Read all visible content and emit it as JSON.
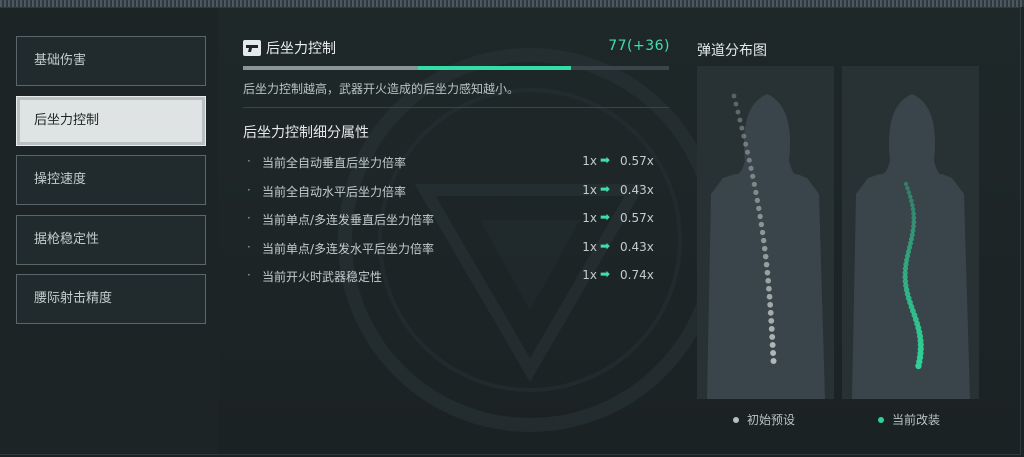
{
  "nav": [
    {
      "label": "基础伤害"
    },
    {
      "label": "后坐力控制",
      "active": true
    },
    {
      "label": "操控速度"
    },
    {
      "label": "据枪稳定性"
    },
    {
      "label": "腰际射击精度"
    }
  ],
  "stat": {
    "title": "后坐力控制",
    "value": "77(+36)",
    "base_fraction": 0.41,
    "total_fraction": 0.77,
    "description": "后坐力控制越高，武器开火造成的后坐力感知越小。"
  },
  "details": {
    "heading": "后坐力控制细分属性",
    "rows": [
      {
        "label": "当前全自动垂直后坐力倍率",
        "from": "1x",
        "to": "0.57x"
      },
      {
        "label": "当前全自动水平后坐力倍率",
        "from": "1x",
        "to": "0.43x"
      },
      {
        "label": "当前单点/多连发垂直后坐力倍率",
        "from": "1x",
        "to": "0.57x"
      },
      {
        "label": "当前单点/多连发水平后坐力倍率",
        "from": "1x",
        "to": "0.43x"
      },
      {
        "label": "当前开火时武器稳定性",
        "from": "1x",
        "to": "0.74x"
      }
    ]
  },
  "spread": {
    "title": "弹道分布图",
    "legend_default": "初始预设",
    "legend_current": "当前改装",
    "colors": {
      "default": "#b8bfc0",
      "current": "#2fd196"
    }
  },
  "colors": {
    "accent": "#3fe0a7",
    "active_nav_bg": "#dfe3e3"
  },
  "icons": {
    "title_icon": "pistol-icon",
    "row_arrow": "arrow-right-icon"
  }
}
